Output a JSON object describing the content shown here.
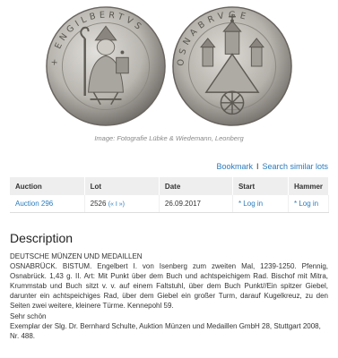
{
  "image": {
    "caption": "Image: Fotografie Lübke & Wiedemann, Leonberg",
    "legend_obverse": "+ ENGILBERTVS",
    "legend_reverse": "OSNABRVGE",
    "metal_color": "#b9b6b0"
  },
  "actions": {
    "bookmark": "Bookmark",
    "separator": "I",
    "search_similar": "Search similar lots"
  },
  "table": {
    "headers": {
      "auction": "Auction",
      "lot": "Lot",
      "date": "Date",
      "start": "Start",
      "hammer": "Hammer"
    },
    "row": {
      "auction": "Auction 296",
      "lot": "2526",
      "lot_prev": "(«",
      "lot_sep": "I",
      "lot_next": "»)",
      "date": "26.09.2017",
      "start": "* Log in",
      "hammer": "* Log in"
    }
  },
  "description": {
    "title": "Description",
    "category": "DEUTSCHE MÜNZEN UND MEDAILLEN",
    "text": "OSNABRÜCK. BISTUM. Engelbert I. von Isenberg zum zweiten Mal, 1239-1250. Pfennig, Osnabrück. 1,43 g. II. Art: Mit Punkt über dem Buch und achtspeichigem Rad. Bischof mit Mitra, Krummstab und Buch sitzt v. v. auf einem Faltstuhl, über dem Buch Punkt//Ein spitzer Giebel, darunter ein achtspeichiges Rad, über dem Giebel ein großer Turm, darauf Kugelkreuz, zu den Seiten zwei weitere, kleinere Türme. Kennepohl 59.",
    "grade": "Sehr schön",
    "provenance": "Exemplar der Slg. Dr. Bernhard Schulte, Auktion Münzen und Medaillen GmbH 28, Stuttgart 2008, Nr. 488."
  },
  "colors": {
    "link": "#2a7bbd",
    "header_bg": "#eeeeee"
  }
}
